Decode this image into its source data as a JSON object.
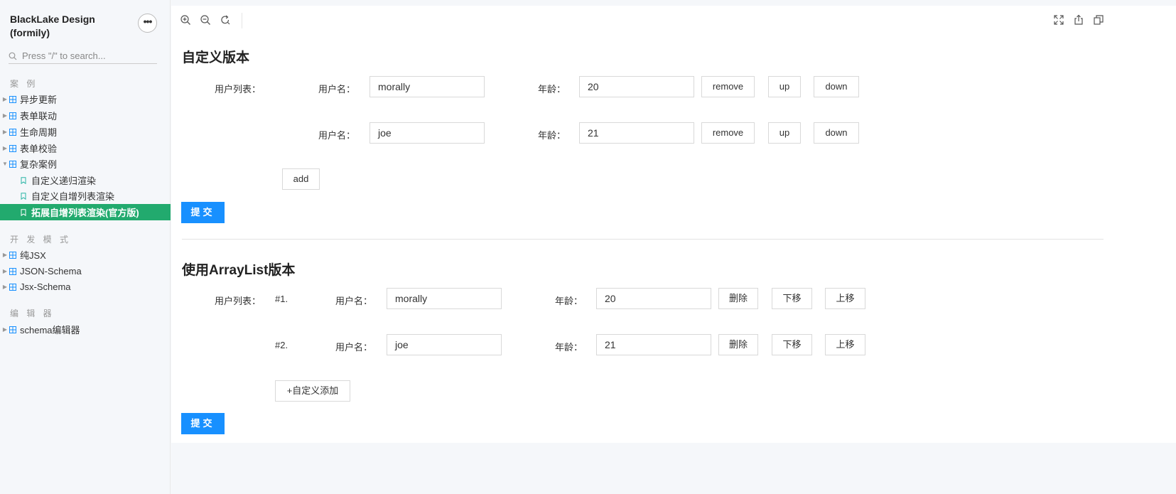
{
  "sidebar": {
    "brand": "BlackLake Design (formily)",
    "more_label": "•••",
    "search_placeholder": "Press \"/\" to search...",
    "groups": [
      {
        "title": "案 例"
      },
      {
        "title": "开 发 模 式"
      },
      {
        "title": "编 辑 器"
      }
    ],
    "items": [
      {
        "label": "异步更新"
      },
      {
        "label": "表单联动"
      },
      {
        "label": "生命周期"
      },
      {
        "label": "表单校验"
      },
      {
        "label": "复杂案例"
      },
      {
        "label": "自定义递归渲染"
      },
      {
        "label": "自定义自增列表渲染"
      },
      {
        "label": "拓展自增列表渲染(官方版)"
      },
      {
        "label": "纯JSX"
      },
      {
        "label": "JSON-Schema"
      },
      {
        "label": "Jsx-Schema"
      },
      {
        "label": "schema编辑器"
      }
    ]
  },
  "toolbar": {
    "icons": [
      "zoom-in-icon",
      "zoom-out-icon",
      "reset-icon",
      "fullscreen-icon",
      "share-icon",
      "copy-icon"
    ]
  },
  "section1": {
    "title": "自定义版本",
    "list_label": "用户列表：",
    "name_label": "用户名：",
    "age_label": "年龄：",
    "rows": [
      {
        "name": "morally",
        "age": "20"
      },
      {
        "name": "joe",
        "age": "21"
      }
    ],
    "remove_label": "remove",
    "up_label": "up",
    "down_label": "down",
    "add_label": "add",
    "submit_label": "提交"
  },
  "section2": {
    "title": "使用ArrayList版本",
    "list_label": "用户列表：",
    "name_label": "用户名：",
    "age_label": "年龄：",
    "rows": [
      {
        "index": "#1.",
        "name": "morally",
        "age": "20"
      },
      {
        "index": "#2.",
        "name": "joe",
        "age": "21"
      }
    ],
    "delete_label": "删除",
    "move_down_label": "下移",
    "move_up_label": "上移",
    "add_label": "+自定义添加",
    "submit_label": "提交"
  },
  "colors": {
    "accent_green": "#22aa6e",
    "primary_blue": "#1890ff",
    "icon_blue": "#1890ff"
  }
}
